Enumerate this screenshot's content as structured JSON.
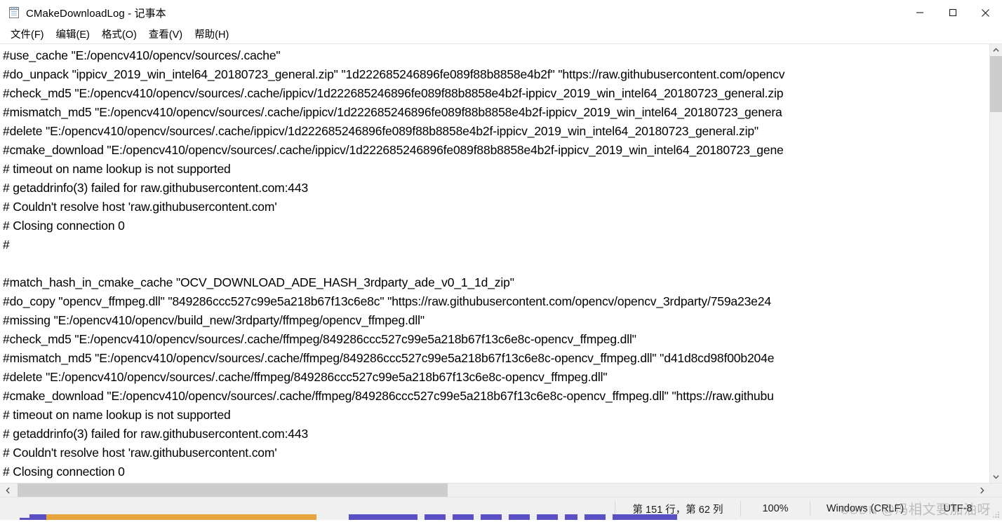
{
  "window": {
    "title": "CMakeDownloadLog - 记事本",
    "icon": "notepad-icon",
    "controls": {
      "minimize": "−",
      "maximize": "□",
      "close": "✕"
    }
  },
  "menubar": {
    "items": [
      {
        "label": "文件(F)",
        "name": "menu-file"
      },
      {
        "label": "编辑(E)",
        "name": "menu-edit"
      },
      {
        "label": "格式(O)",
        "name": "menu-format"
      },
      {
        "label": "查看(V)",
        "name": "menu-view"
      },
      {
        "label": "帮助(H)",
        "name": "menu-help"
      }
    ]
  },
  "editor": {
    "lines": [
      "#use_cache \"E:/opencv410/opencv/sources/.cache\"",
      "#do_unpack \"ippicv_2019_win_intel64_20180723_general.zip\" \"1d222685246896fe089f88b8858e4b2f\" \"https://raw.githubusercontent.com/opencv",
      "#check_md5 \"E:/opencv410/opencv/sources/.cache/ippicv/1d222685246896fe089f88b8858e4b2f-ippicv_2019_win_intel64_20180723_general.zip",
      "#mismatch_md5 \"E:/opencv410/opencv/sources/.cache/ippicv/1d222685246896fe089f88b8858e4b2f-ippicv_2019_win_intel64_20180723_genera",
      "#delete \"E:/opencv410/opencv/sources/.cache/ippicv/1d222685246896fe089f88b8858e4b2f-ippicv_2019_win_intel64_20180723_general.zip\"",
      "#cmake_download \"E:/opencv410/opencv/sources/.cache/ippicv/1d222685246896fe089f88b8858e4b2f-ippicv_2019_win_intel64_20180723_gene",
      "# timeout on name lookup is not supported",
      "# getaddrinfo(3) failed for raw.githubusercontent.com:443",
      "# Couldn't resolve host 'raw.githubusercontent.com'",
      "# Closing connection 0",
      "#",
      "",
      "#match_hash_in_cmake_cache \"OCV_DOWNLOAD_ADE_HASH_3rdparty_ade_v0_1_1d_zip\"",
      "#do_copy \"opencv_ffmpeg.dll\" \"849286ccc527c99e5a218b67f13c6e8c\" \"https://raw.githubusercontent.com/opencv/opencv_3rdparty/759a23e24",
      "#missing \"E:/opencv410/opencv/build_new/3rdparty/ffmpeg/opencv_ffmpeg.dll\"",
      "#check_md5 \"E:/opencv410/opencv/sources/.cache/ffmpeg/849286ccc527c99e5a218b67f13c6e8c-opencv_ffmpeg.dll\"",
      "#mismatch_md5 \"E:/opencv410/opencv/sources/.cache/ffmpeg/849286ccc527c99e5a218b67f13c6e8c-opencv_ffmpeg.dll\" \"d41d8cd98f00b204e",
      "#delete \"E:/opencv410/opencv/sources/.cache/ffmpeg/849286ccc527c99e5a218b67f13c6e8c-opencv_ffmpeg.dll\"",
      "#cmake_download \"E:/opencv410/opencv/sources/.cache/ffmpeg/849286ccc527c99e5a218b67f13c6e8c-opencv_ffmpeg.dll\" \"https://raw.githubu",
      "# timeout on name lookup is not supported",
      "# getaddrinfo(3) failed for raw.githubusercontent.com:443",
      "# Couldn't resolve host 'raw.githubusercontent.com'",
      "# Closing connection 0"
    ]
  },
  "scrollbars": {
    "vertical": {
      "up_arrow": "⌃",
      "down_arrow": "⌄"
    },
    "horizontal": {
      "left_arrow": "❮",
      "right_arrow": "❯"
    }
  },
  "statusbar": {
    "position": "第 151 行，第 62 列",
    "zoom": "100%",
    "line_ending": "Windows (CRLF)",
    "encoding": "UTF-8"
  },
  "watermark": {
    "brand": "CSDN",
    "user": "@冯相文要加油呀"
  },
  "colors": {
    "window_bg": "#ffffff",
    "chrome_bg": "#f0f0f0",
    "text": "#000000",
    "scroll_thumb": "#cdcdcd",
    "accent": "#5b4fc4",
    "taskbar_orange": "#e8a33d"
  }
}
